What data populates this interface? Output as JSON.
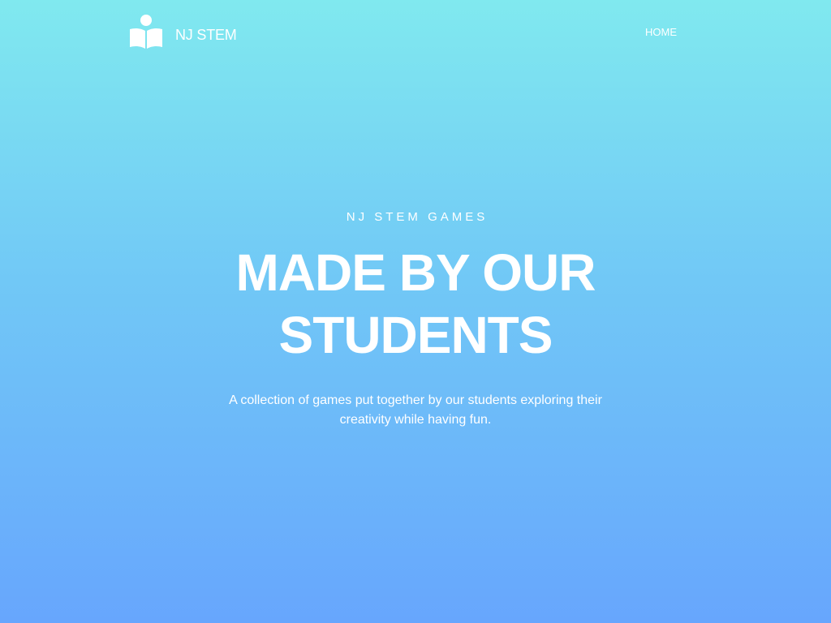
{
  "nav": {
    "brand_name": "NJ STEM",
    "logo_icon": "reading-person-icon",
    "links": [
      {
        "label": "HOME"
      }
    ]
  },
  "hero": {
    "eyebrow": "NJ STEM GAMES",
    "headline_line1": "MADE BY OUR",
    "headline_line2": "STUDENTS",
    "subtitle": "A collection of games put together by our students exploring their creativity while having fun."
  },
  "colors": {
    "gradient_top": "#80e9ef",
    "gradient_bottom": "#67a6fd",
    "text": "#ffffff"
  }
}
